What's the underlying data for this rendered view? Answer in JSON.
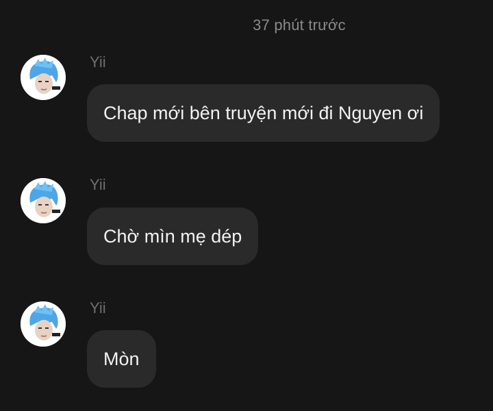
{
  "header": {
    "timestamp": "37 phút trước"
  },
  "messages": [
    {
      "sender": "Yii",
      "text": "Chap mới bên truyện mới đi Nguyen ơi"
    },
    {
      "sender": "Yii",
      "text": "Chờ mìn mẹ dép"
    },
    {
      "sender": "Yii",
      "text": "Mòn"
    }
  ],
  "colors": {
    "background": "#161616",
    "bubble": "#2a2a2a",
    "avatar_hair": "#4fa6e6"
  }
}
